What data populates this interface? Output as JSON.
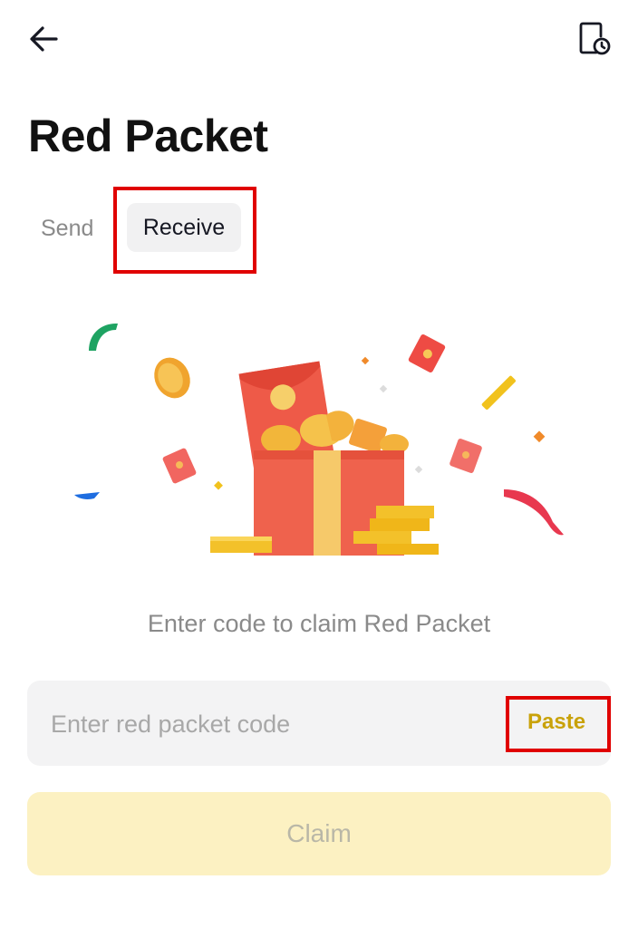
{
  "header": {
    "back_icon": "arrow-left-icon",
    "history_icon": "history-clock-icon"
  },
  "page": {
    "title": "Red Packet"
  },
  "tabs": [
    {
      "label": "Send",
      "selected": false
    },
    {
      "label": "Receive",
      "selected": true
    }
  ],
  "illustration": {
    "icon": "gift-box-red-packet-illustration"
  },
  "receive": {
    "prompt": "Enter code to claim Red Packet",
    "code_placeholder": "Enter red packet code",
    "code_value": "",
    "paste_label": "Paste",
    "claim_label": "Claim"
  },
  "colors": {
    "accent_gold": "#c9a20a",
    "claim_bg": "#fcf1c2",
    "highlight": "#e00000",
    "packet_red": "#f05a48"
  }
}
